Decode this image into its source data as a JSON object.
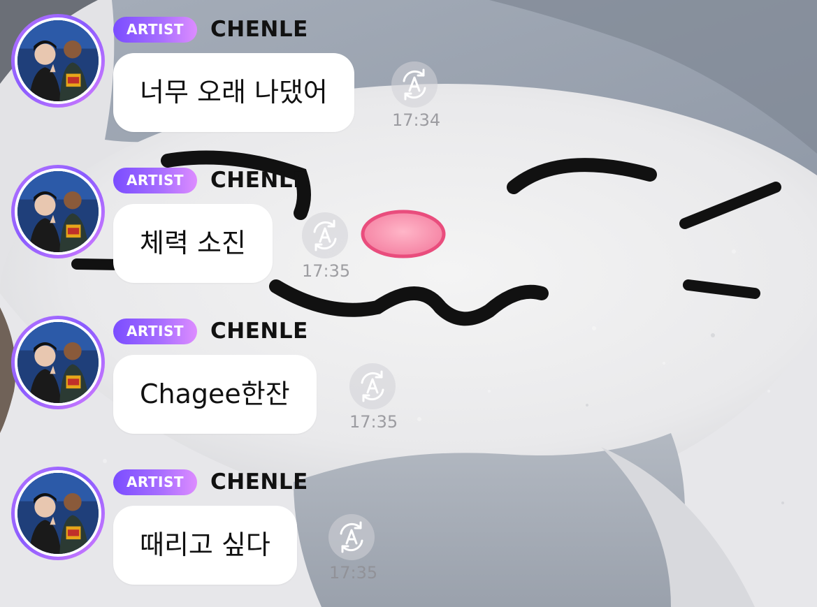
{
  "messages": [
    {
      "badge": "ARTIST",
      "name": "CHENLE",
      "text": "너무 오래 나댔어",
      "time": "17:34"
    },
    {
      "badge": "ARTIST",
      "name": "CHENLE",
      "text": "체력 소진",
      "time": "17:35"
    },
    {
      "badge": "ARTIST",
      "name": "CHENLE",
      "text": "Chagee한잔",
      "time": "17:35"
    },
    {
      "badge": "ARTIST",
      "name": "CHENLE",
      "text": "때리고 싶다",
      "time": "17:35"
    }
  ],
  "icons": {
    "translate": "translate-icon",
    "avatar": "avatar"
  },
  "colors": {
    "badge_start": "#7a4dff",
    "badge_end": "#dd8cff",
    "bubble": "#ffffff",
    "timestamp": "#8f8f94"
  }
}
